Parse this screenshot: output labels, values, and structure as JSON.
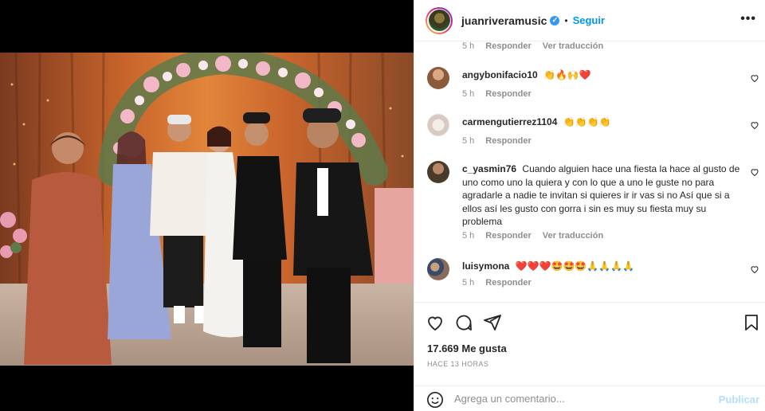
{
  "post": {
    "username": "juanriveramusic",
    "verified_badge": "✓",
    "separator": "•",
    "follow_label": "Seguir",
    "more_label": "•••"
  },
  "first_meta": {
    "time": "5 h",
    "reply": "Responder",
    "translation": "Ver traducción"
  },
  "comments": [
    {
      "username": "angybonifacio10",
      "text": "👏🔥🙌❤️",
      "time": "5 h",
      "reply": "Responder",
      "translation": ""
    },
    {
      "username": "carmengutierrez1104",
      "text": "👏👏👏👏",
      "time": "5 h",
      "reply": "Responder",
      "translation": ""
    },
    {
      "username": "c_yasmin76",
      "text": "Cuando alguien hace una fiesta la hace al gusto de uno como uno la quiera y con lo que a uno le guste no para agradarle a nadie te invitan si quieres ir ir vas si no Así que si a ellos así les gusto con gorra i sin es muy su fiesta muy su problema",
      "time": "5 h",
      "reply": "Responder",
      "translation": "Ver traducción"
    },
    {
      "username": "luisymona",
      "text": "❤️❤️❤️🤩🤩🤩🙏🙏🙏🙏",
      "time": "5 h",
      "reply": "Responder",
      "translation": ""
    }
  ],
  "actions": {
    "likes": "17.669 Me gusta",
    "timestamp": "HACE 13 HORAS"
  },
  "composer": {
    "placeholder": "Agrega un comentario...",
    "publish_label": "Publicar"
  },
  "icons": {
    "like": "heart-icon",
    "comment": "comment-icon",
    "share": "share-icon",
    "save": "bookmark-icon",
    "emoji": "emoji-icon"
  },
  "colors": {
    "accent": "#0095f6",
    "publish_disabled": "#b2dffc",
    "muted": "#8e8e8e"
  }
}
